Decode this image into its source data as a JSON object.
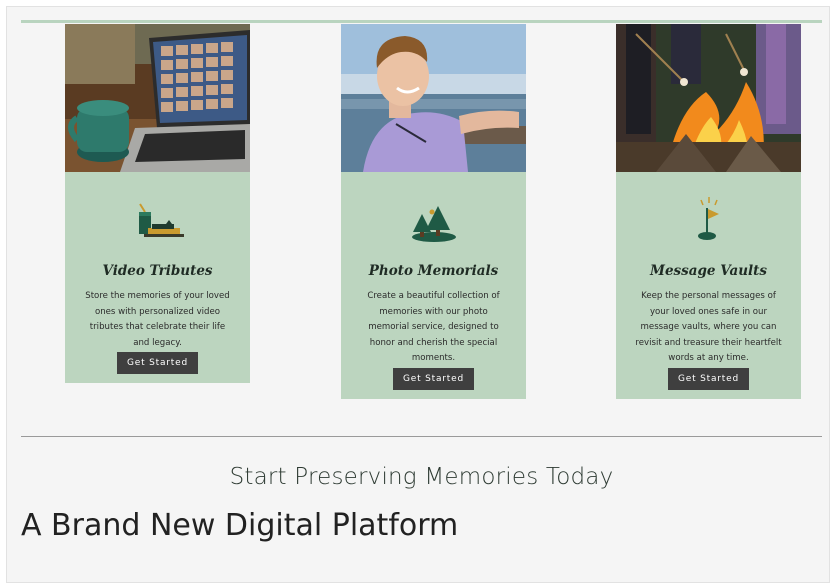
{
  "cards": [
    {
      "title": "Video Tributes",
      "description": "Store the memories of your loved ones with personalized video tributes that celebrate their life and legacy.",
      "button": "Get Started",
      "icon": "tea-and-cake-icon",
      "photo": "laptop-video-call-with-mug"
    },
    {
      "title": "Photo Memorials",
      "description": "Create a beautiful collection of memories with our photo memorial service, designed to honor and cherish the special moments.",
      "button": "Get Started",
      "icon": "pine-trees-icon",
      "photo": "smiling-boy-by-lake"
    },
    {
      "title": "Message Vaults",
      "description": "Keep the personal messages of your loved ones safe in our message vaults, where you can revisit and treasure their heartfelt words at any time.",
      "button": "Get Started",
      "icon": "golf-flag-icon",
      "photo": "campfire-with-marshmallows"
    }
  ],
  "cta": {
    "text": "Start Preserving Memories Today"
  },
  "heading": {
    "text": "A Brand New Digital Platform"
  },
  "colors": {
    "page_background": "#f5f5f5",
    "card_background": "#bcd5bf",
    "accent_rule": "#b9d4bf",
    "button_background": "#3f3f3f",
    "button_text": "#ffffff"
  }
}
